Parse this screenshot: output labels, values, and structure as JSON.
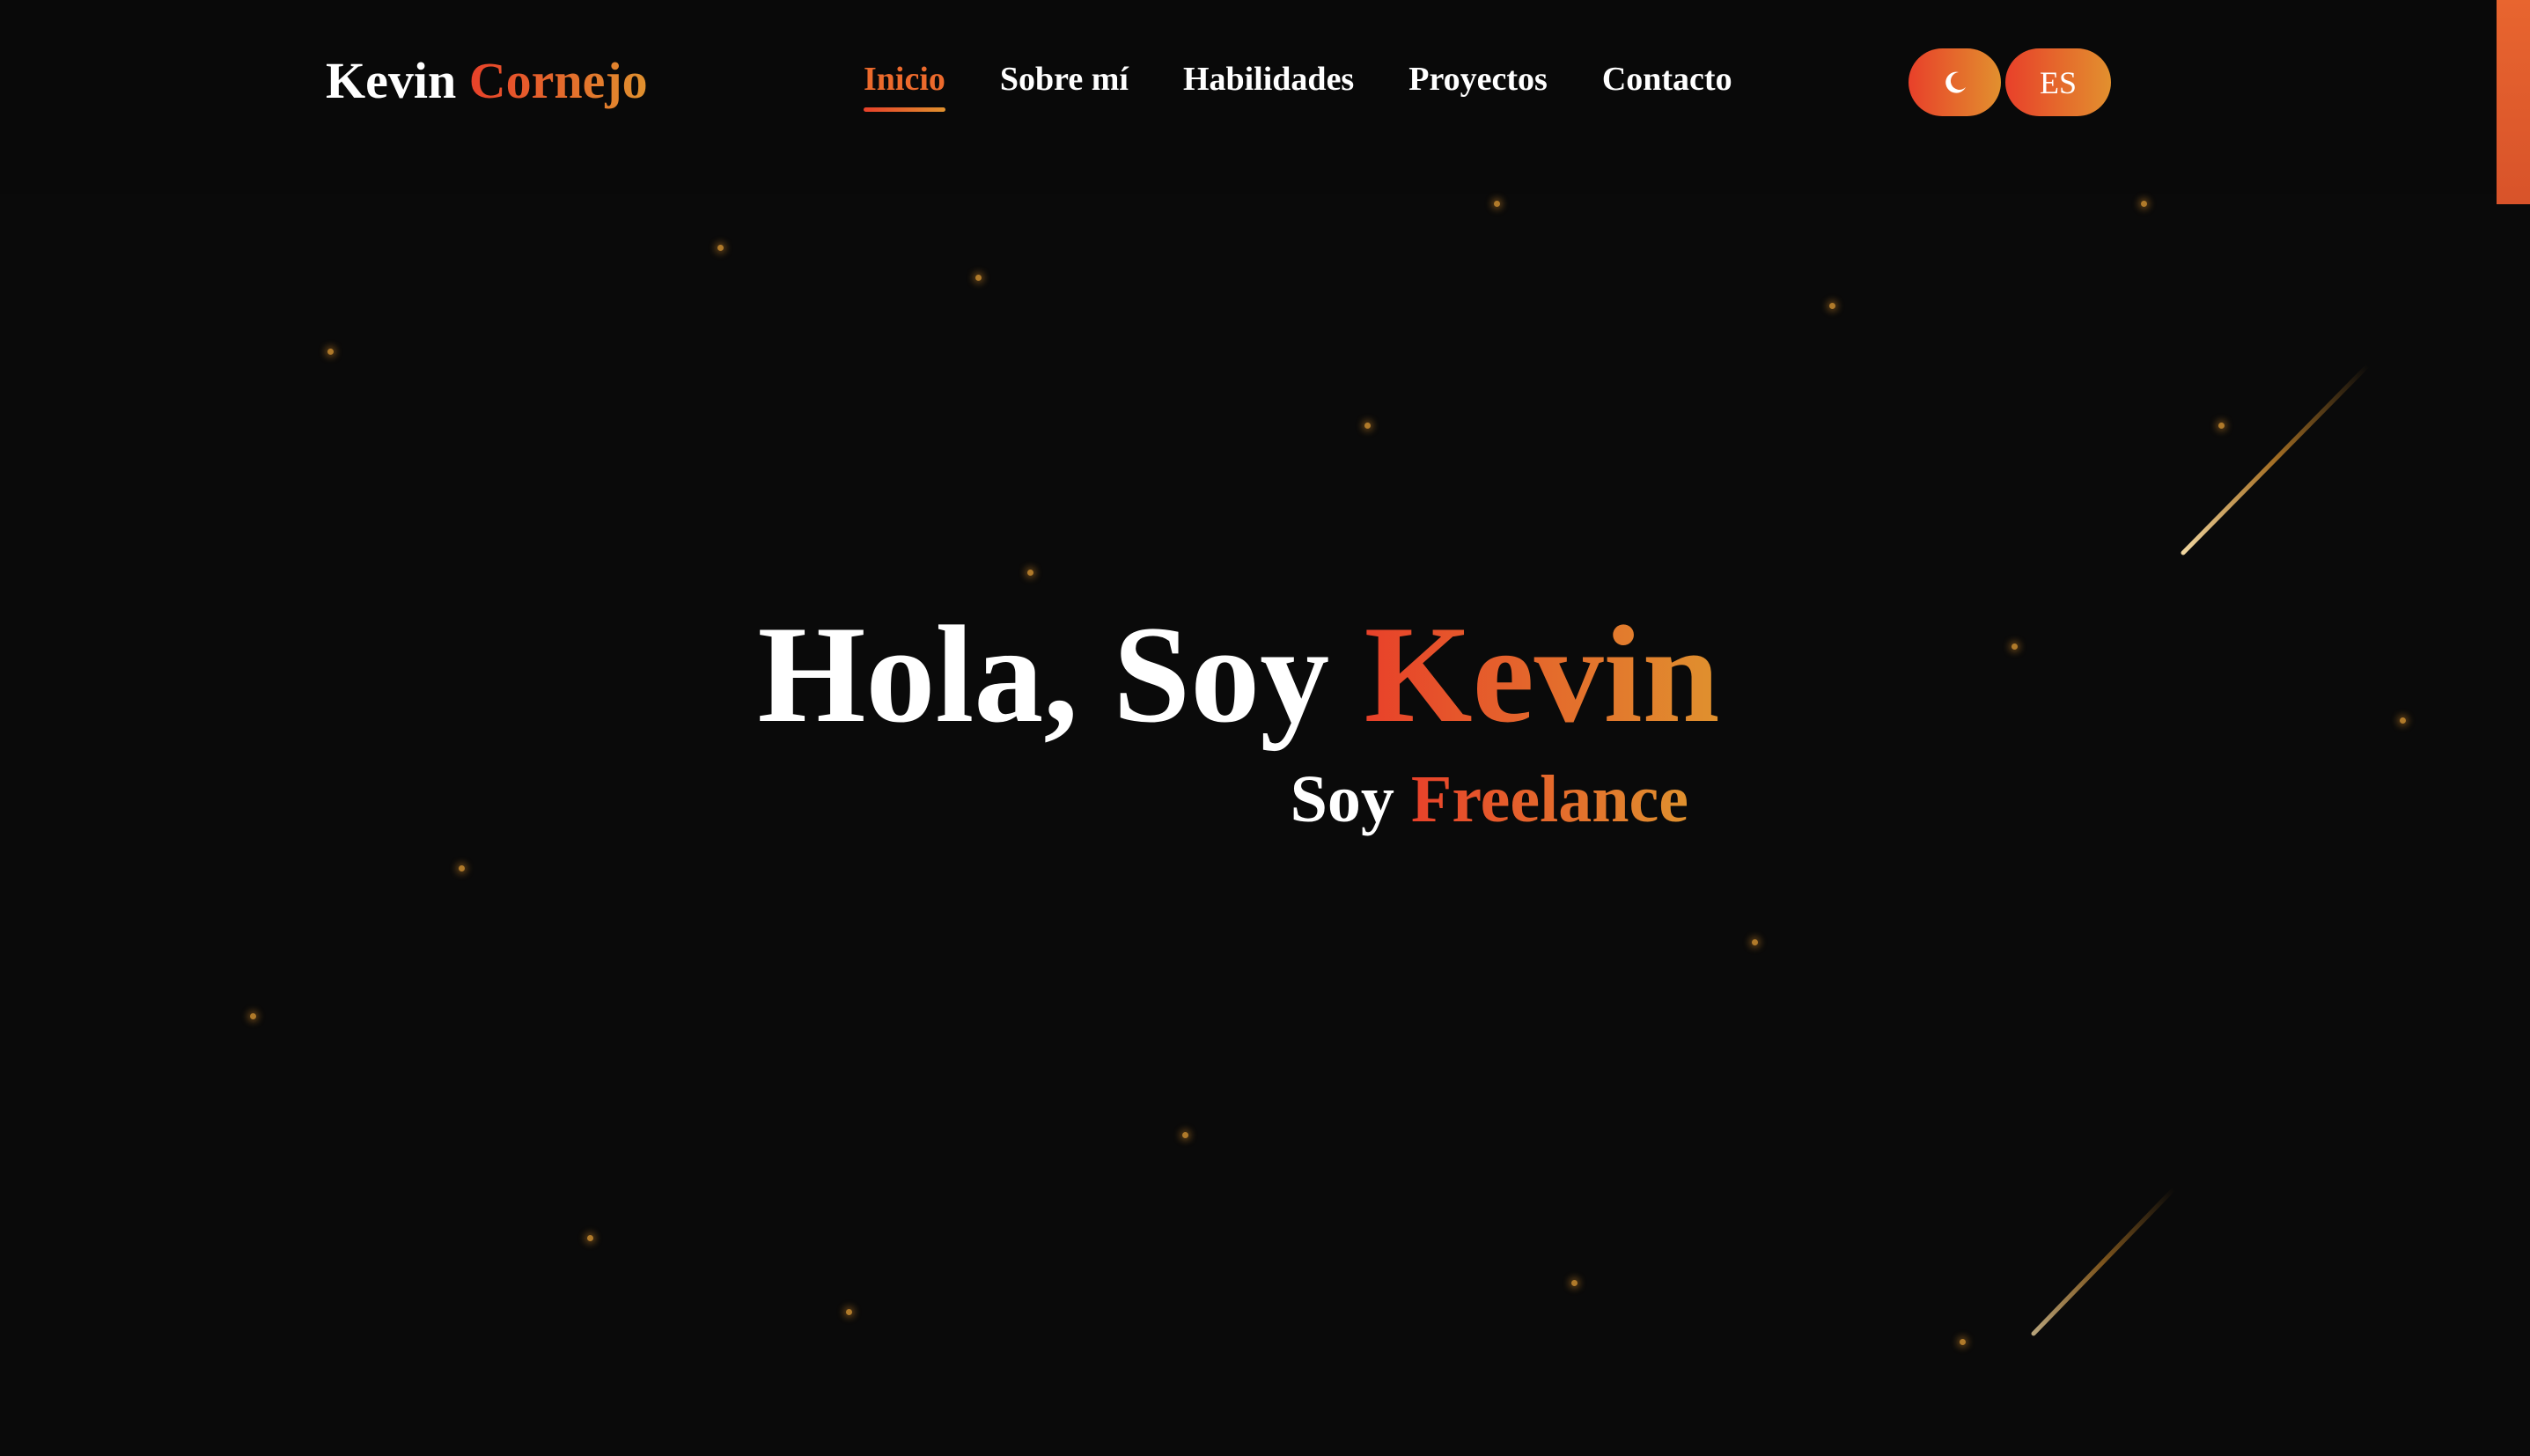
{
  "header": {
    "logo_first": "Kevin",
    "logo_second": "Cornejo",
    "nav": [
      {
        "label": "Inicio",
        "active": true
      },
      {
        "label": "Sobre mí",
        "active": false
      },
      {
        "label": "Habilidades",
        "active": false
      },
      {
        "label": "Proyectos",
        "active": false
      },
      {
        "label": "Contacto",
        "active": false
      }
    ],
    "theme_toggle_icon": "moon-icon",
    "language_label": "ES"
  },
  "hero": {
    "title_prefix": "Hola, Soy",
    "title_name": "Kevin",
    "subtitle_prefix": "Soy",
    "subtitle_role": "Freelance"
  },
  "colors": {
    "background": "#0a0a0a",
    "accent_start": "#e8412a",
    "accent_end": "#e0912e",
    "text": "#ffffff",
    "star": "#b07a2a"
  }
}
